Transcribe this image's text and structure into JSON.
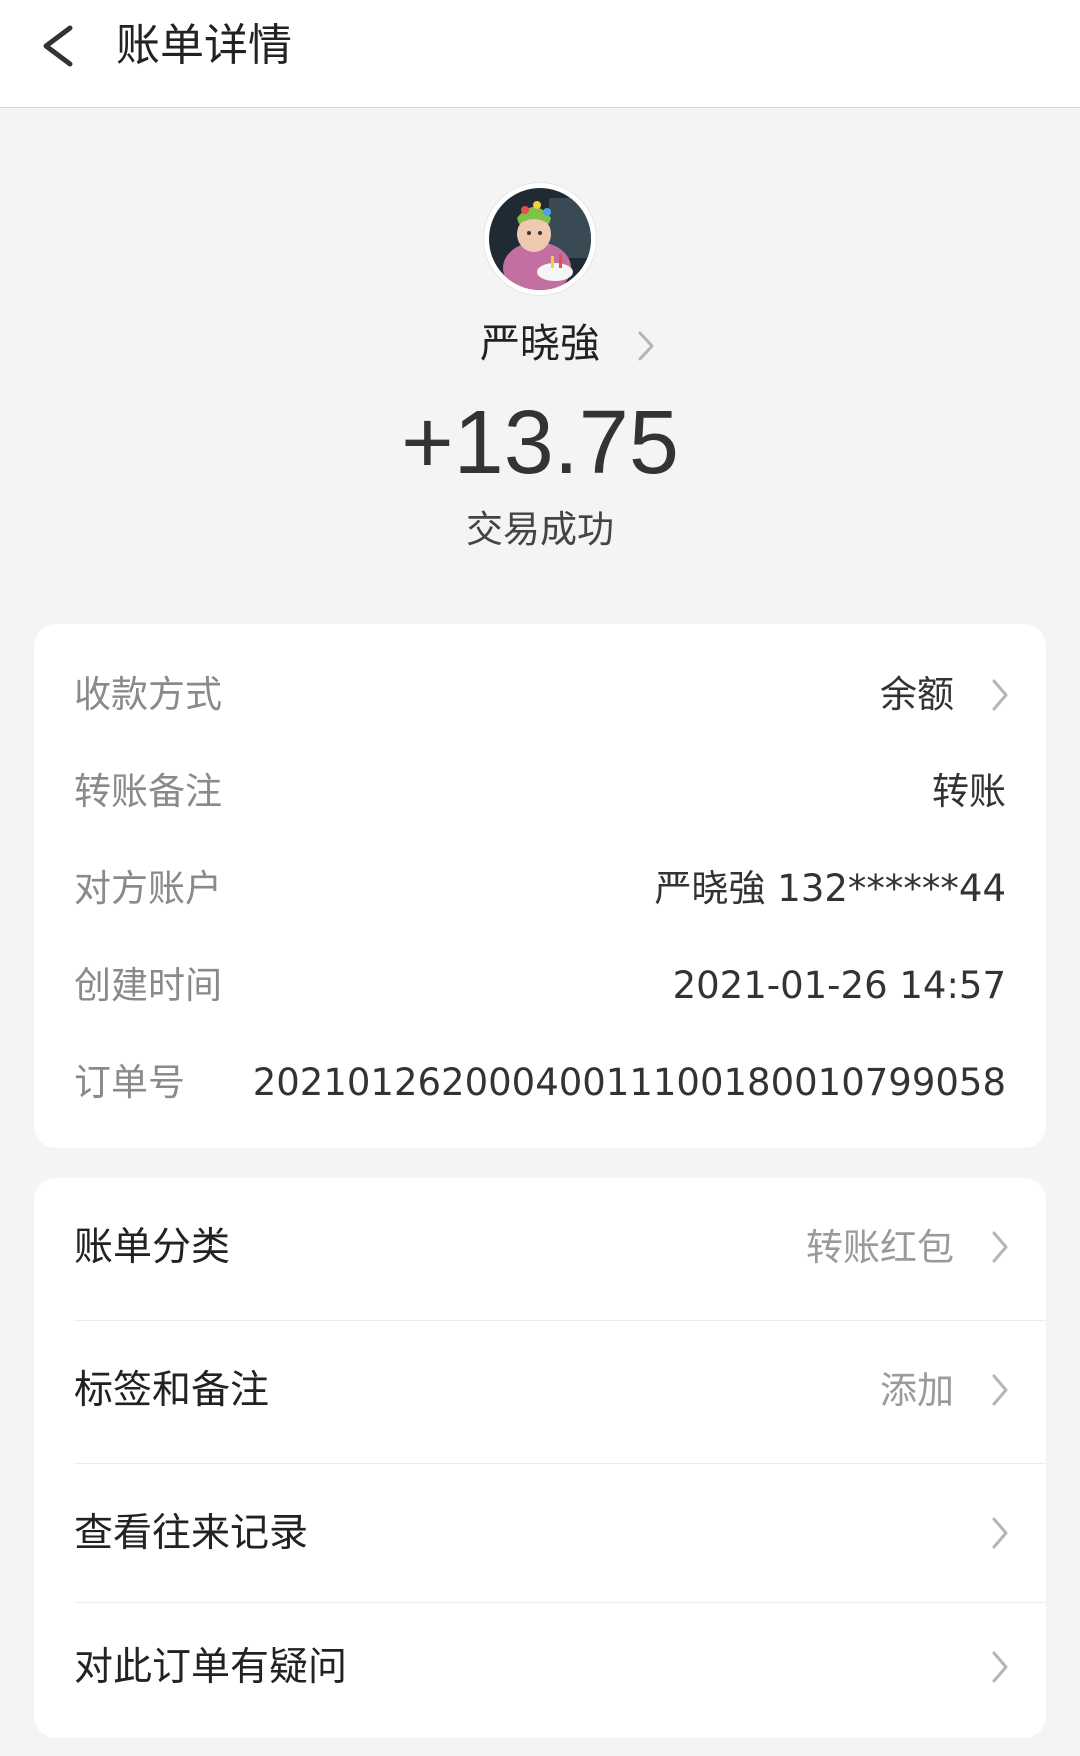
{
  "header": {
    "title": "账单详情",
    "back_icon": "chevron-left-icon"
  },
  "profile": {
    "avatar": "avatar-photo",
    "name": "严晓強",
    "amount": "+13.75",
    "status": "交易成功"
  },
  "details": [
    {
      "label": "收款方式",
      "value": "余额",
      "has_chevron": true
    },
    {
      "label": "转账备注",
      "value": "转账",
      "has_chevron": false
    },
    {
      "label": "对方账户",
      "value": "严晓強 132******44",
      "has_chevron": false
    },
    {
      "label": "创建时间",
      "value": "2021-01-26 14:57",
      "has_chevron": false
    },
    {
      "label": "订单号",
      "value": "20210126200040011100180010799058",
      "has_chevron": false
    }
  ],
  "actions": [
    {
      "label": "账单分类",
      "value": "转账红包"
    },
    {
      "label": "标签和备注",
      "value": "添加"
    },
    {
      "label": "查看往来记录",
      "value": ""
    },
    {
      "label": "对此订单有疑问",
      "value": ""
    }
  ],
  "colors": {
    "background": "#f4f4f4",
    "card": "#ffffff",
    "label_gray": "#8a8a8a",
    "text_dark": "#333333"
  }
}
